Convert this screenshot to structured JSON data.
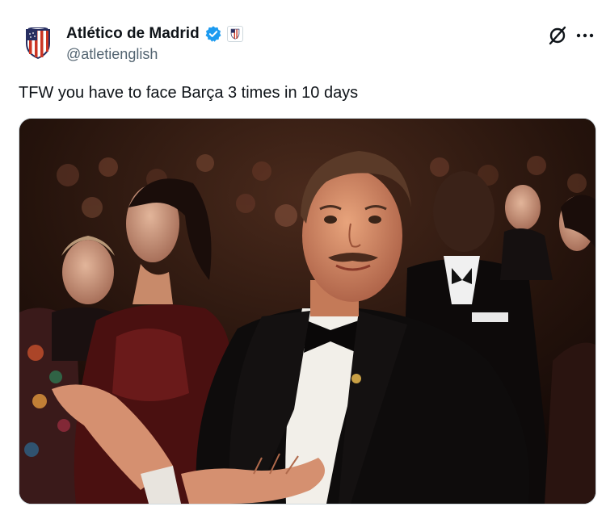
{
  "tweet": {
    "display_name": "Atlético de Madrid",
    "handle": "@atletienglish",
    "text": "TFW you have to face Barça 3 times in 10 days"
  },
  "icons": {
    "verified": "verified-badge-icon",
    "affiliate": "atletico-crest-icon",
    "grok": "grok-icon",
    "more": "more-options-icon"
  },
  "colors": {
    "verified_blue": "#1d9bf0",
    "text_primary": "#0f1419",
    "text_secondary": "#536471",
    "crest_red": "#cb3524",
    "crest_blue": "#272e61"
  },
  "media": {
    "type": "photo"
  }
}
